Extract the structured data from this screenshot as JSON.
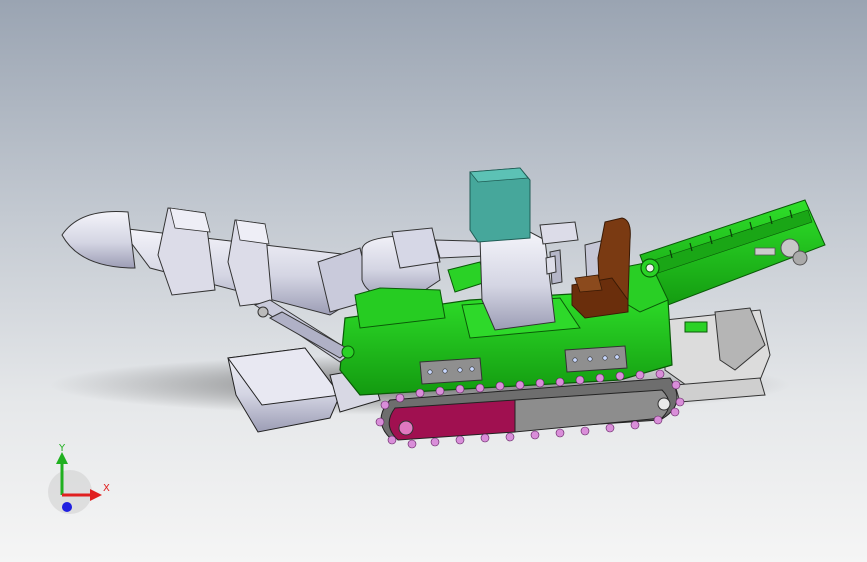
{
  "viewport": {
    "background_top": "#9aa4b2",
    "background_bottom": "#f5f5f5"
  },
  "model": {
    "colors": {
      "body_green": "#22c41e",
      "body_dark_green": "#0f7d0c",
      "steel_light": "#e3e3ee",
      "steel_mid": "#c5c6d6",
      "steel_dark": "#8e8fa6",
      "teal_box": "#46a79b",
      "brown_seat": "#7a3a12",
      "track_chain": "#d98ed9",
      "track_plate_red": "#a01050",
      "track_plate_gray": "#8d8d8d"
    }
  },
  "triad": {
    "x_label": "X",
    "y_label": "Y",
    "x_color": "#e02020",
    "y_color": "#20b020",
    "z_color": "#2020e0"
  }
}
